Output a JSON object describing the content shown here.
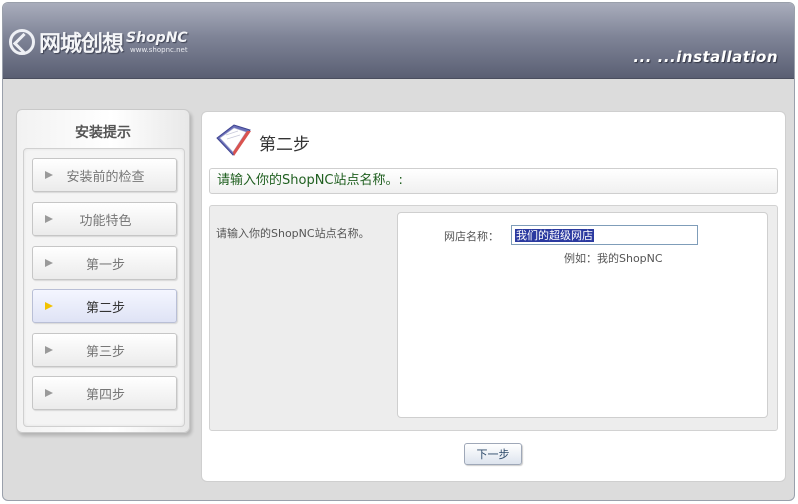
{
  "header": {
    "logo_cn": "网城创想",
    "logo_brand": "ShopNC",
    "logo_url": "www.shopnc.net",
    "install_title": "... ...installation"
  },
  "sidebar": {
    "title": "安装提示",
    "items": [
      {
        "label": "安装前的检查",
        "active": false
      },
      {
        "label": "功能特色",
        "active": false
      },
      {
        "label": "第一步",
        "active": false
      },
      {
        "label": "第二步",
        "active": true
      },
      {
        "label": "第三步",
        "active": false
      },
      {
        "label": "第四步",
        "active": false
      }
    ]
  },
  "main": {
    "step_title": "第二步",
    "prompt": "请输入你的ShopNC站点名称。:",
    "form": {
      "description": "请输入你的ShopNC站点名称。",
      "store_name_label": "网店名称：",
      "store_name_value": "我们的超级网店",
      "hint": "例如：我的ShopNC"
    },
    "next_button": "下一步"
  },
  "colors": {
    "header_dark": "#5a5f73",
    "prompt_text": "#1f5f1f",
    "active_arrow": "#f2c200"
  },
  "icons": {
    "step": "open-book-icon",
    "nav": "triangle-arrow-icon",
    "logo": "refresh-logo-icon"
  }
}
